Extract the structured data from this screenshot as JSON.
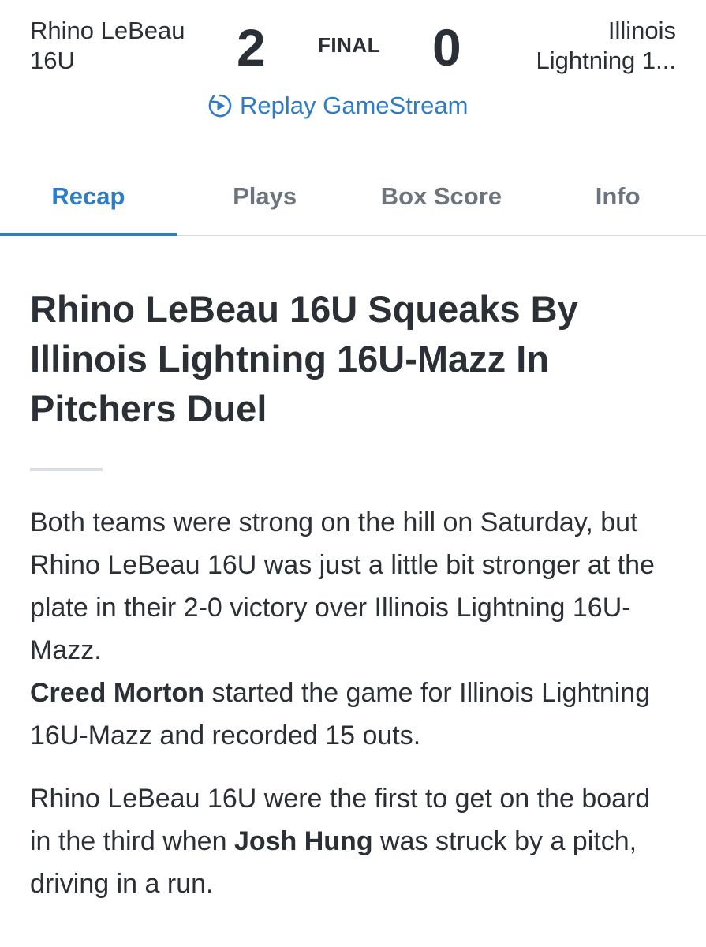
{
  "scoreboard": {
    "home_team": "Rhino LeBeau 16U",
    "home_score": "2",
    "status": "FINAL",
    "away_score": "0",
    "away_team_line1": "Illinois",
    "away_team_line2": "Lightning 1...",
    "replay_label": "Replay GameStream",
    "replay_icon": "replay-icon",
    "accent_color": "#2f7cc6"
  },
  "tabs": [
    {
      "label": "Recap",
      "active": true
    },
    {
      "label": "Plays",
      "active": false
    },
    {
      "label": "Box Score",
      "active": false
    },
    {
      "label": "Info",
      "active": false
    }
  ],
  "article": {
    "headline": "Rhino LeBeau 16U Squeaks By Illinois Lightning 16U-Mazz In Pitchers Duel",
    "paragraphs": [
      {
        "text": "Both teams were strong on the hill on Saturday, but Rhino LeBeau 16U was just a little bit stronger at the plate in their 2-0 victory over Illinois Lightning 16U-Mazz.",
        "bold_name": "Creed Morton",
        "text_after": " started the game for Illinois Lightning 16U-Mazz and recorded 15 outs."
      },
      {
        "text_before": "Rhino LeBeau 16U were the first to get on the board in the third when ",
        "bold_name": "Josh Hung",
        "text_after": " was struck by a pitch, driving in a run."
      }
    ]
  }
}
